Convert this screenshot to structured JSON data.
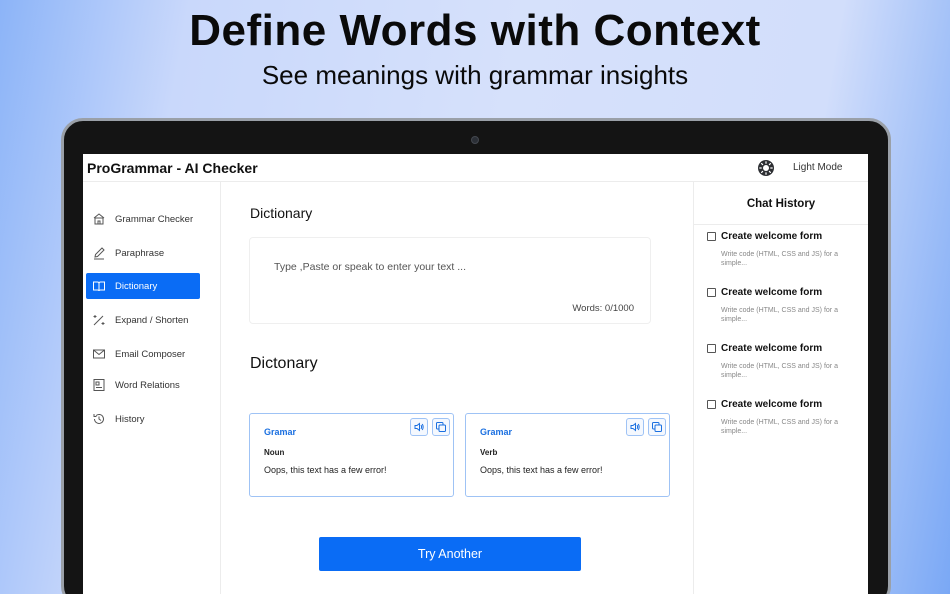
{
  "hero": {
    "title": "Define Words with Context",
    "subtitle": "See meanings with grammar insights"
  },
  "app": {
    "title": "ProGrammar - AI Checker",
    "theme_icon": "sun-icon",
    "theme_label": "Light Mode"
  },
  "sidebar": {
    "items": [
      {
        "label": "Grammar Checker",
        "icon": "grammar-icon",
        "active": false
      },
      {
        "label": "Paraphrase",
        "icon": "pencil-icon",
        "active": false
      },
      {
        "label": "Dictionary",
        "icon": "book-icon",
        "active": true
      },
      {
        "label": "Expand / Shorten",
        "icon": "wand-icon",
        "active": false
      },
      {
        "label": "Email Composer",
        "icon": "mail-icon",
        "active": false
      },
      {
        "label": "Word Relations",
        "icon": "image-icon",
        "active": false
      },
      {
        "label": "History",
        "icon": "history-icon",
        "active": false
      }
    ]
  },
  "main": {
    "section_title": "Dictionary",
    "input": {
      "placeholder": "Type ,Paste or speak to enter your text  ...",
      "word_count": "Words: 0/1000"
    },
    "results_title": "Dictonary",
    "cards": [
      {
        "term": "Gramar",
        "pos": "Noun",
        "definition": "Oops, this text has a few error!"
      },
      {
        "term": "Gramar",
        "pos": "Verb",
        "definition": "Oops, this text has a few error!"
      }
    ],
    "cta_label": "Try Another"
  },
  "history": {
    "title": "Chat History",
    "items": [
      {
        "name": "Create welcome form",
        "desc": "Write code (HTML, CSS and JS) for a simple..."
      },
      {
        "name": "Create welcome form",
        "desc": "Write code (HTML, CSS and JS) for a simple..."
      },
      {
        "name": "Create welcome form",
        "desc": "Write code (HTML, CSS and JS) for a simple..."
      },
      {
        "name": "Create welcome form",
        "desc": "Write code (HTML, CSS and JS) for a simple..."
      }
    ]
  },
  "colors": {
    "accent": "#0a6cf5",
    "card_border": "#9fc3f5",
    "term_blue": "#1a6fe0"
  }
}
